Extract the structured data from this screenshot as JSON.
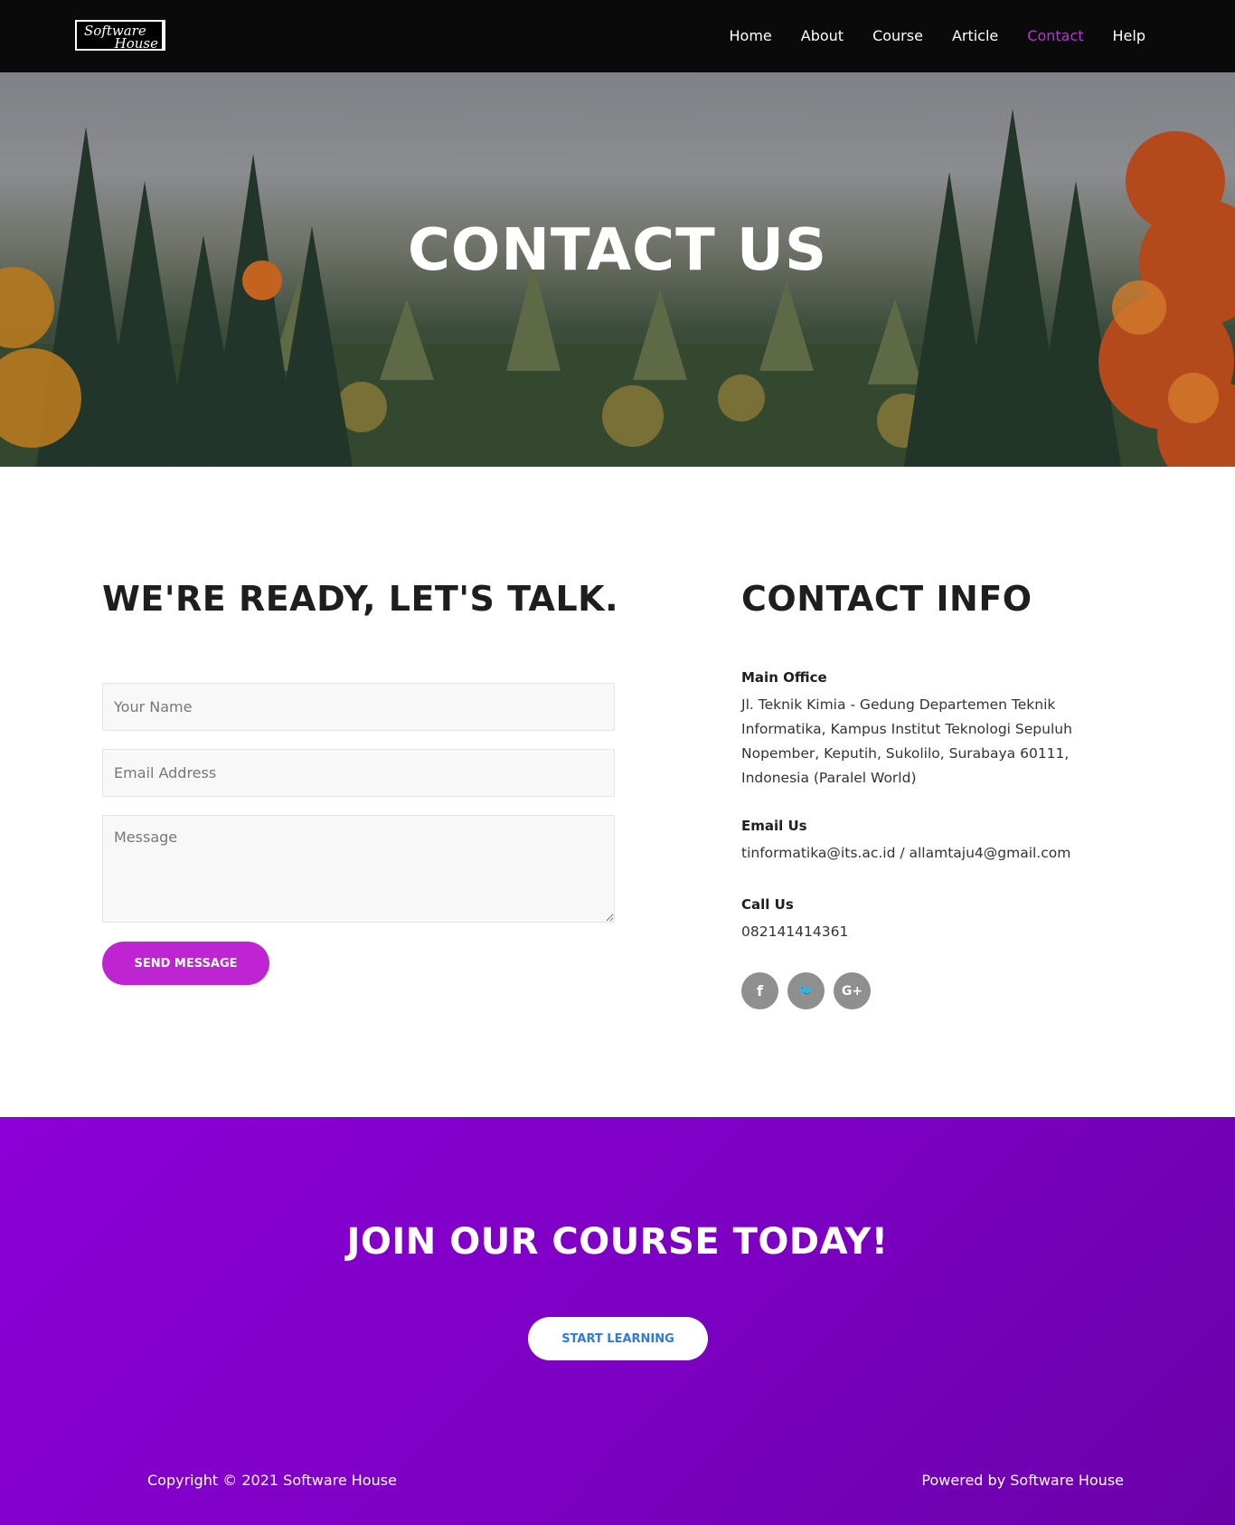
{
  "nav": {
    "logo_line1": "Software",
    "logo_line2": "House",
    "links": [
      {
        "label": "Home"
      },
      {
        "label": "About"
      },
      {
        "label": "Course"
      },
      {
        "label": "Article"
      },
      {
        "label": "Contact",
        "active": true
      },
      {
        "label": "Help"
      }
    ],
    "active_color": "#b833d6"
  },
  "hero": {
    "title": "CONTACT US"
  },
  "form": {
    "heading": "WE'RE READY, LET'S TALK.",
    "name_placeholder": "Your Name",
    "email_placeholder": "Email Address",
    "message_placeholder": "Message",
    "send_label": "SEND MESSAGE",
    "button_color": "#bf24d3"
  },
  "info": {
    "heading": "CONTACT INFO",
    "office_label": "Main Office",
    "office_text": "Jl. Teknik Kimia - Gedung Departemen Teknik Informatika, Kampus Institut Teknologi Sepuluh Nopember, Keputih, Sukolilo, Surabaya 60111, Indonesia (Paralel World)",
    "email_label": "Email Us",
    "email_text": "tinformatika@its.ac.id / allamtaju4@gmail.com",
    "call_label": "Call Us",
    "call_text": "082141414361",
    "social": [
      {
        "icon": "facebook-icon",
        "glyph": "f"
      },
      {
        "icon": "twitter-icon",
        "glyph": "🐦"
      },
      {
        "icon": "google-plus-icon",
        "glyph": "G+"
      }
    ]
  },
  "cta": {
    "title": "JOIN OUR COURSE TODAY!",
    "button_label": "START LEARNING",
    "button_text_color": "#2f7bd8",
    "background_color": "#7c00c2"
  },
  "footer": {
    "copyright": "Copyright © 2021 Software House",
    "powered": "Powered by Software House"
  }
}
